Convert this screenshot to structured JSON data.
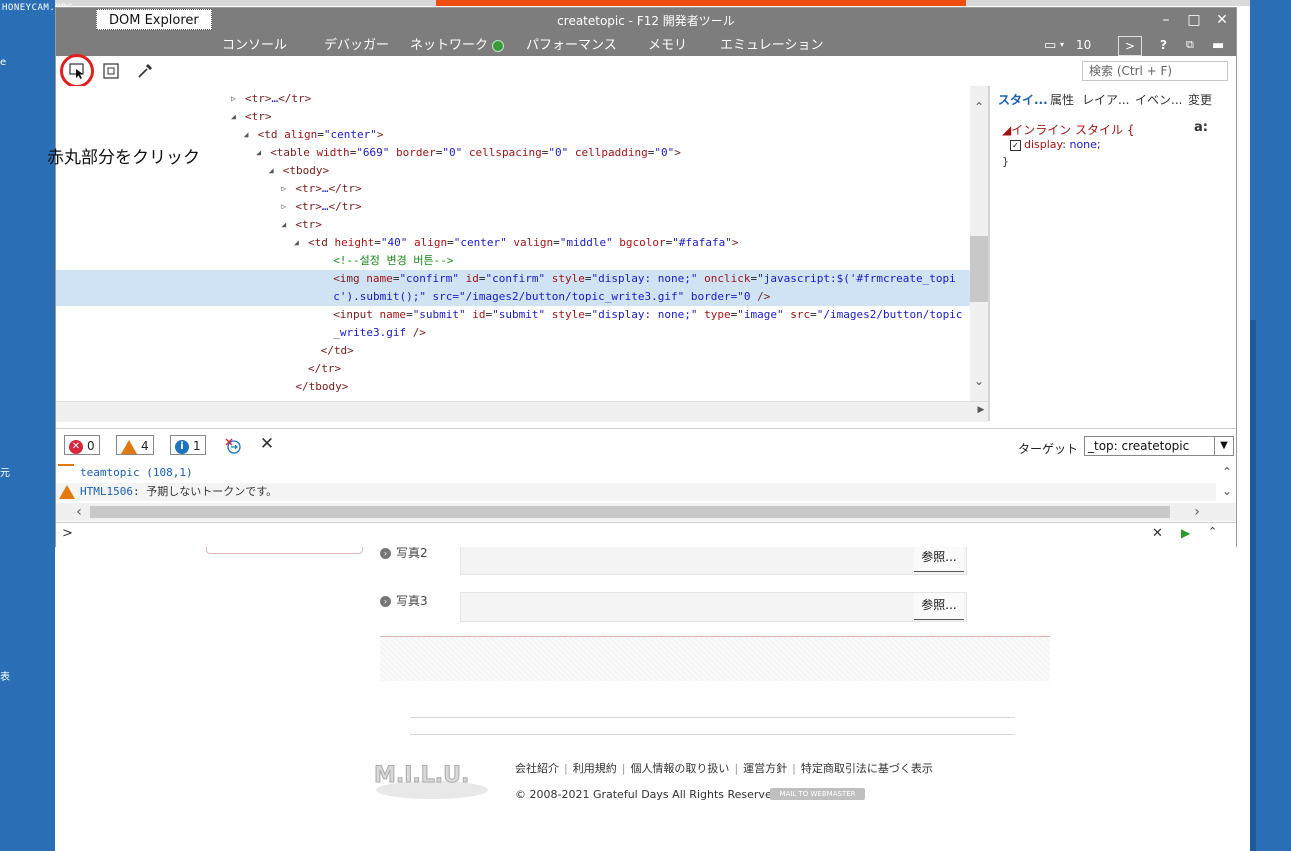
{
  "watermark": "HONEYCAM.ORG",
  "edge_glyphs": [
    "e",
    "元",
    "表"
  ],
  "devtools": {
    "window_title": "createtopic - F12 開発者ツール",
    "tabs": [
      "DOM Explorer",
      "コンソール",
      "デバッガー",
      "ネットワーク",
      "パフォーマンス",
      "メモリ",
      "エミュレーション"
    ],
    "active_tab": "DOM Explorer",
    "tab_right": {
      "emulation_count": "10",
      "help": "?"
    },
    "search_placeholder": "検索 (Ctrl + F)",
    "dom_lines": [
      {
        "indent": 15,
        "tri": "▷",
        "html": "<tr>…</tr>"
      },
      {
        "indent": 15,
        "tri": "◢",
        "html": "<tr>"
      },
      {
        "indent": 16,
        "tri": "◢",
        "html": "<td align=\"center\">"
      },
      {
        "indent": 17,
        "tri": "◢",
        "html": "<table width=\"669\" border=\"0\" cellspacing=\"0\" cellpadding=\"0\">"
      },
      {
        "indent": 18,
        "tri": "◢",
        "html": "<tbody>"
      },
      {
        "indent": 19,
        "tri": "▷",
        "html": "<tr>…</tr>"
      },
      {
        "indent": 19,
        "tri": "▷",
        "html": "<tr>…</tr>"
      },
      {
        "indent": 19,
        "tri": "◢",
        "html": "<tr>"
      },
      {
        "indent": 20,
        "tri": "◢",
        "html": "<td height=\"40\" align=\"center\" valign=\"middle\" bgcolor=\"#fafafa\">"
      },
      {
        "indent": 22,
        "tri": "",
        "html": "<!--설정 변경 버튼-->"
      },
      {
        "indent": 22,
        "tri": "",
        "html": "<img name=\"confirm\" id=\"confirm\" style=\"display: none;\" onclick=\"javascript:$('#frmcreate_topi"
      },
      {
        "indent": 22,
        "tri": "",
        "html": "c').submit();\" src=\"/images2/button/topic_write3.gif\" border=\"0\" />"
      },
      {
        "indent": 22,
        "tri": "",
        "html": "<input name=\"submit\" id=\"submit\" style=\"display: none;\" type=\"image\" src=\"/images2/button/topic"
      },
      {
        "indent": 22,
        "tri": "",
        "html": "_write3.gif\" />"
      },
      {
        "indent": 21,
        "tri": "",
        "html": "</td>"
      },
      {
        "indent": 20,
        "tri": "",
        "html": "</tr>"
      },
      {
        "indent": 19,
        "tri": "",
        "html": "</tbody>"
      }
    ],
    "styles_tabs": [
      "スタイ...",
      "属性",
      "レイア...",
      "イベン...",
      "変更"
    ],
    "inline_style_title": "◢インライン スタイル  {",
    "inline_prop_name": "display",
    "inline_prop_value": "none;",
    "inline_close": "}",
    "aa_label": "a:",
    "console": {
      "errors": "0",
      "warnings": "4",
      "info": "1",
      "target_label": "ターゲット",
      "target_value": "_top: createtopic",
      "line1": "teamtopic (108,1)",
      "line2_code": "HTML1506",
      "line2_text": ": 予期しないトークンです。",
      "prompt": ">"
    }
  },
  "annotation": "赤丸部分をクリック",
  "page": {
    "photo2_label": "写真2",
    "photo3_label": "写真3",
    "browse_label": "参照...",
    "footer_links": [
      "会社紹介",
      "利用規約",
      "個人情報の取り扱い",
      "運営方針",
      "特定商取引法に基づく表示"
    ],
    "copyright": "© 2008-2021 Grateful Days All Rights Reserved.",
    "mail_badge": "MAIL TO WEBMASTER",
    "logo_text": "M.I.L.U."
  }
}
